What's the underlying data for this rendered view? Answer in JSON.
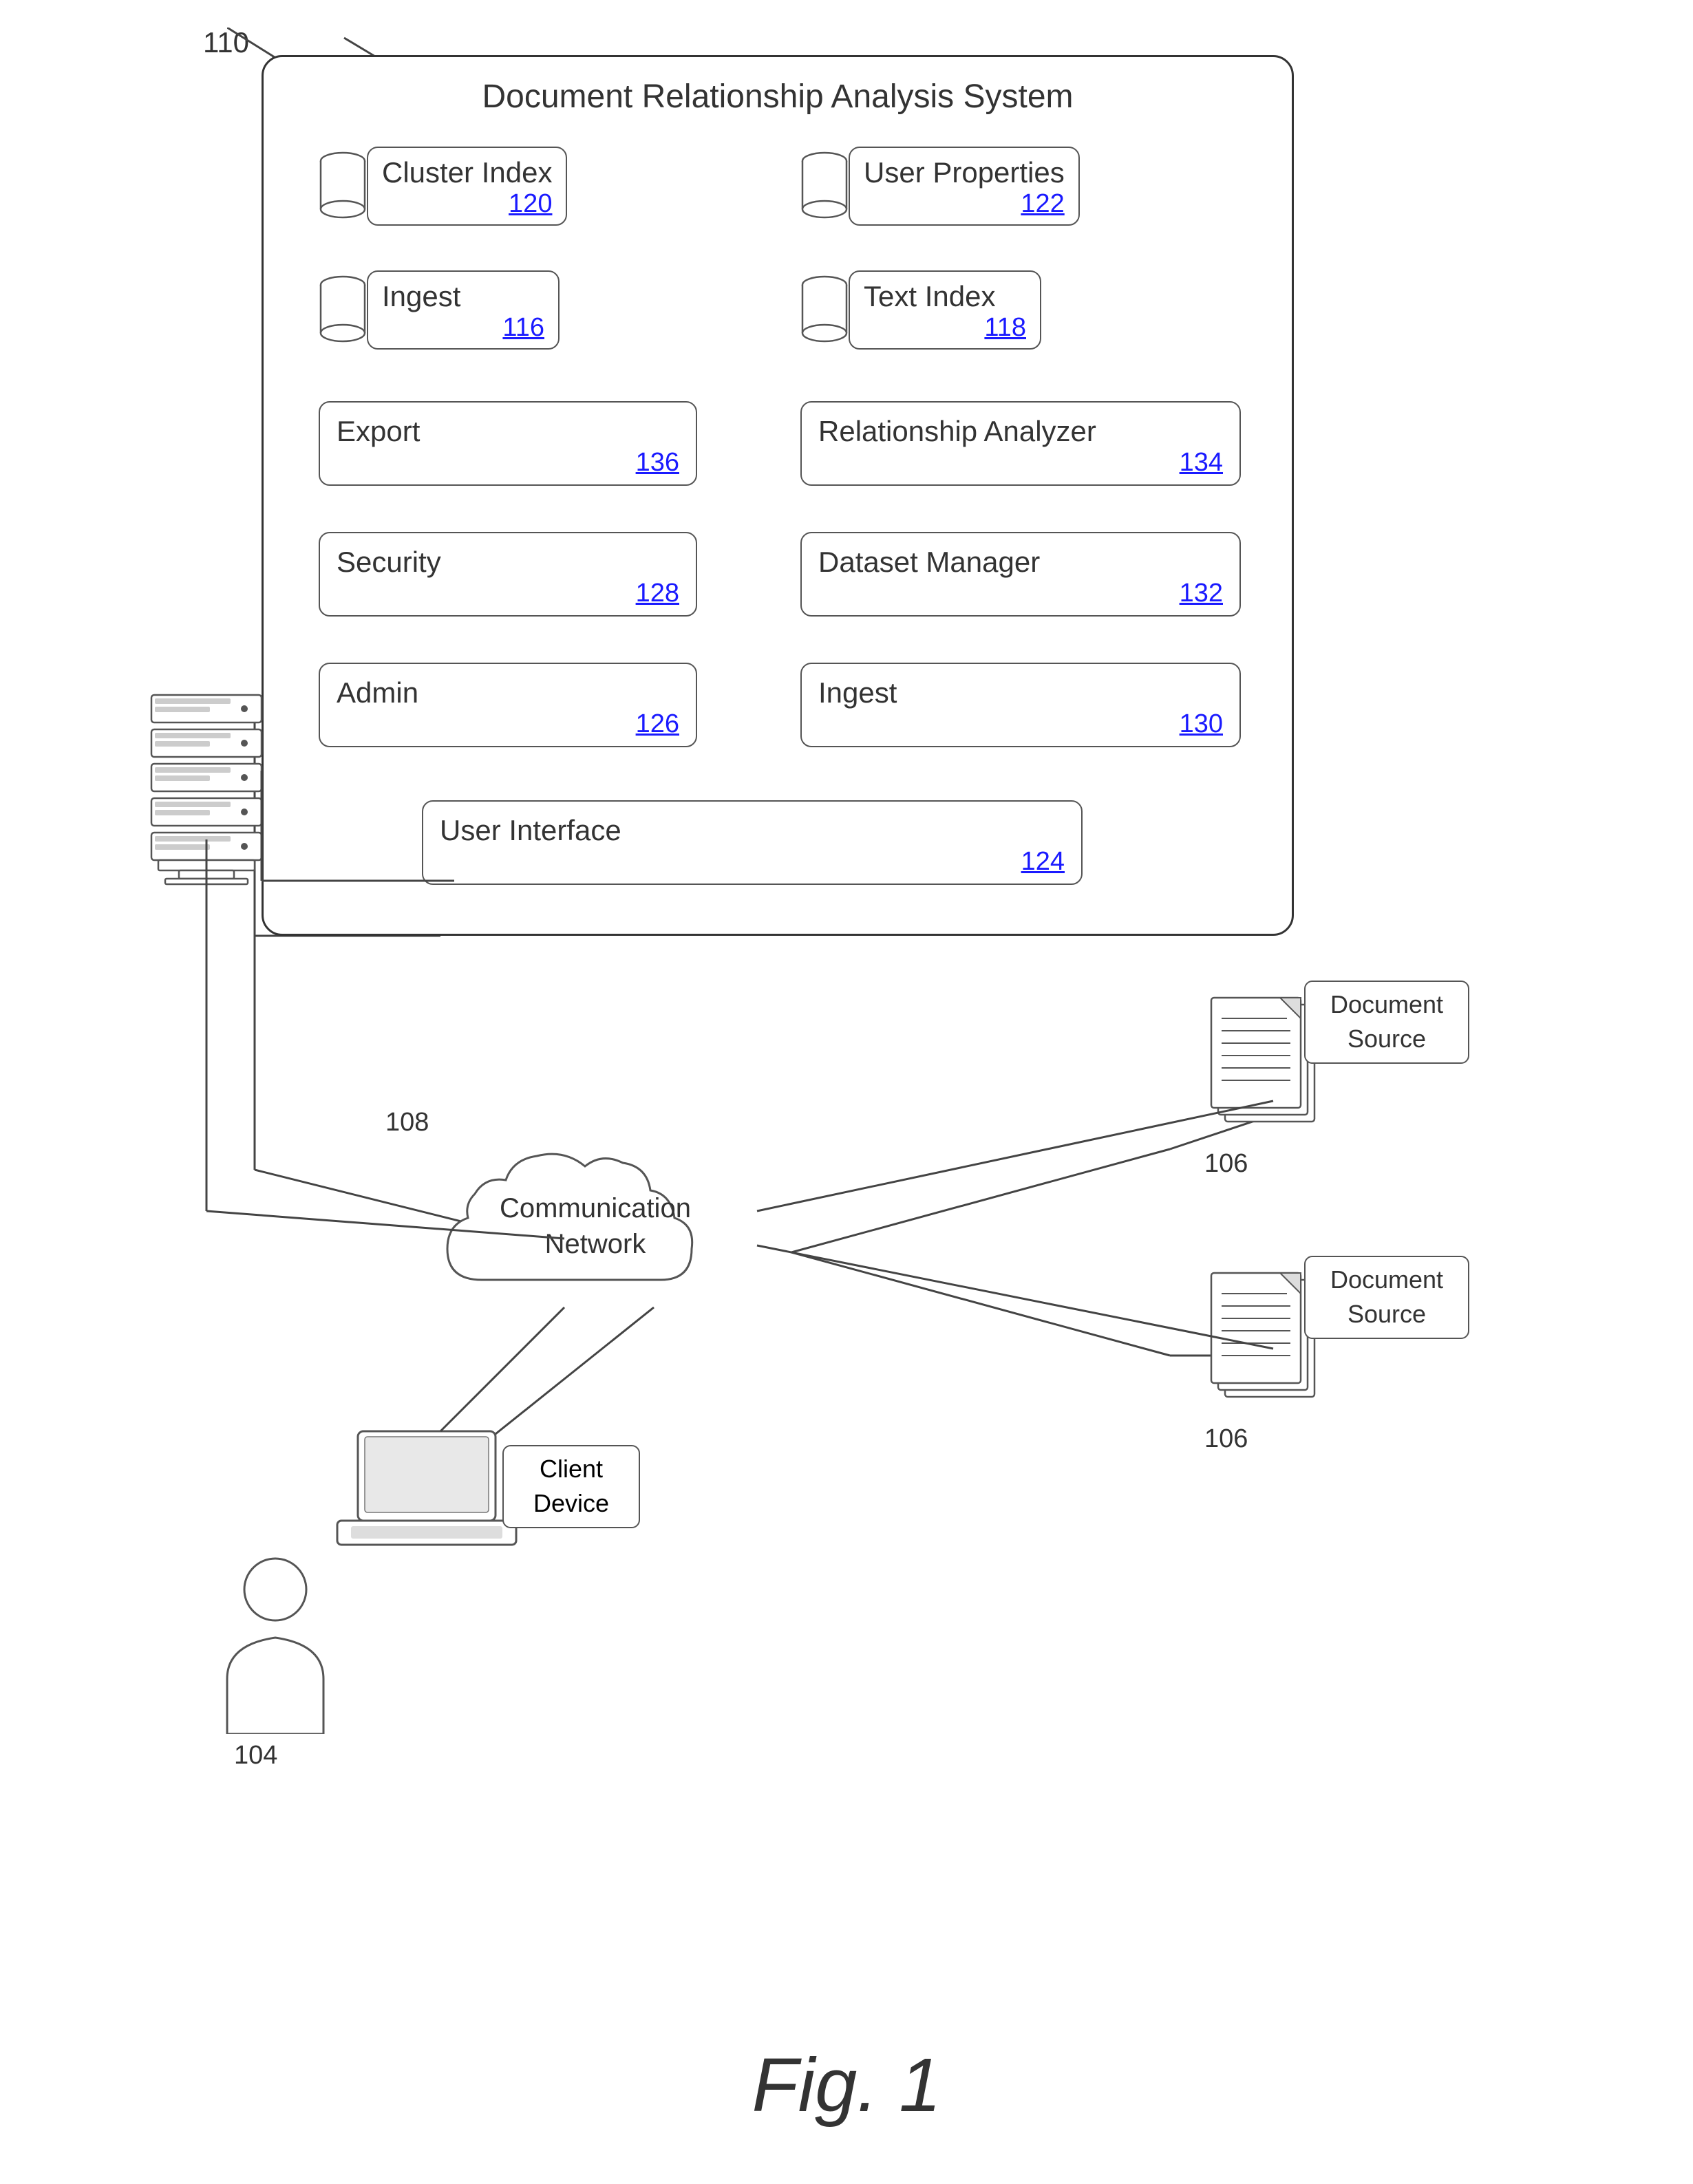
{
  "diagram": {
    "system_label": "Document Relationship Analysis System",
    "ref_110": "110",
    "components": [
      {
        "id": "cluster_index",
        "name": "Cluster Index",
        "number": "120",
        "type": "db",
        "row": 1,
        "col": 1
      },
      {
        "id": "user_properties",
        "name": "User Properties",
        "number": "122",
        "type": "db",
        "row": 1,
        "col": 2
      },
      {
        "id": "ingest_116",
        "name": "Ingest",
        "number": "116",
        "type": "db",
        "row": 2,
        "col": 1
      },
      {
        "id": "text_index",
        "name": "Text Index",
        "number": "118",
        "type": "db",
        "row": 2,
        "col": 2
      },
      {
        "id": "export",
        "name": "Export",
        "number": "136",
        "type": "box",
        "row": 3,
        "col": 1
      },
      {
        "id": "relationship_analyzer",
        "name": "Relationship Analyzer",
        "number": "134",
        "type": "box",
        "row": 3,
        "col": 2
      },
      {
        "id": "security",
        "name": "Security",
        "number": "128",
        "type": "box",
        "row": 4,
        "col": 1
      },
      {
        "id": "dataset_manager",
        "name": "Dataset Manager",
        "number": "132",
        "type": "box",
        "row": 4,
        "col": 2
      },
      {
        "id": "admin",
        "name": "Admin",
        "number": "126",
        "type": "box",
        "row": 5,
        "col": 1
      },
      {
        "id": "ingest_130",
        "name": "Ingest",
        "number": "130",
        "type": "box",
        "row": 5,
        "col": 2
      },
      {
        "id": "user_interface",
        "name": "User Interface",
        "number": "124",
        "type": "box_wide",
        "row": 6
      }
    ],
    "network_nodes": [
      {
        "id": "communication_network",
        "label": "Communication\nNetwork",
        "ref": "108"
      },
      {
        "id": "document_source_1",
        "label": "Document\nSource",
        "ref": "106"
      },
      {
        "id": "document_source_2",
        "label": "Document\nSource",
        "ref": "106"
      },
      {
        "id": "client_device",
        "label": "Client\nDevice",
        "ref": ""
      },
      {
        "id": "user_ref",
        "ref": "104"
      }
    ]
  },
  "figure": {
    "label": "Fig. 1"
  }
}
